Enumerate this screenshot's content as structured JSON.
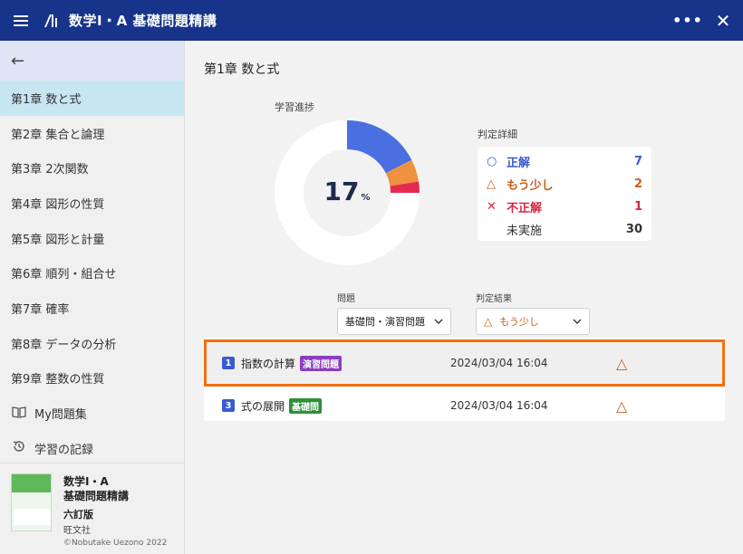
{
  "app": {
    "title": "数学Ⅰ・A 基礎問題精講",
    "more_label": "•••",
    "close_label": "✕"
  },
  "sidebar": {
    "back_label": "←",
    "items": [
      {
        "label": "第1章 数と式",
        "active": true
      },
      {
        "label": "第2章 集合と論理"
      },
      {
        "label": "第3章 2次関数"
      },
      {
        "label": "第4章 図形の性質"
      },
      {
        "label": "第5章 図形と計量"
      },
      {
        "label": "第6章 順列・組合せ"
      },
      {
        "label": "第7章 確率"
      },
      {
        "label": "第8章 データの分析"
      },
      {
        "label": "第9章 整数の性質"
      },
      {
        "label": "My問題集",
        "icon": "book-icon"
      },
      {
        "label": "学習の記録",
        "icon": "history-icon"
      }
    ],
    "book": {
      "title_line1": "数学Ⅰ・A",
      "title_line2": "基礎問題精講",
      "edition": "六訂版",
      "publisher": "旺文社",
      "copyright": "©Nobutake Uezono 2022"
    }
  },
  "main": {
    "chapter_title": "第1章 数と式",
    "progress": {
      "label": "学習進捗",
      "value": "17",
      "unit": "%"
    },
    "detail": {
      "label": "判定詳細",
      "rows": [
        {
          "symbol": "○",
          "label": "正解",
          "count": "7",
          "color": "#3a5bd0"
        },
        {
          "symbol": "△",
          "label": "もう少し",
          "count": "2",
          "color": "#c8601a"
        },
        {
          "symbol": "✕",
          "label": "不正解",
          "count": "1",
          "color": "#d7263d"
        },
        {
          "symbol": "",
          "label": "未実施",
          "count": "30",
          "color": "#333333"
        }
      ]
    },
    "filters": {
      "problem_label": "問題",
      "problem_value": "基礎問・演習問題",
      "result_label": "判定結果",
      "result_symbol": "△",
      "result_value": "もう少し"
    },
    "list": [
      {
        "number": "1",
        "name": "指数の計算",
        "tag": "演習問題",
        "date": "2024/03/04 16:04",
        "mark": "△"
      },
      {
        "number": "3",
        "name": "式の展開",
        "tag": "基礎問",
        "date": "2024/03/04 16:04",
        "mark": "△"
      }
    ]
  },
  "colors": {
    "titlebar": "#17338a",
    "correct": "#4a6fe0",
    "partial": "#f0913f",
    "wrong": "#e8294f",
    "unattempted": "#ffffff",
    "highlight": "#f07010"
  }
}
